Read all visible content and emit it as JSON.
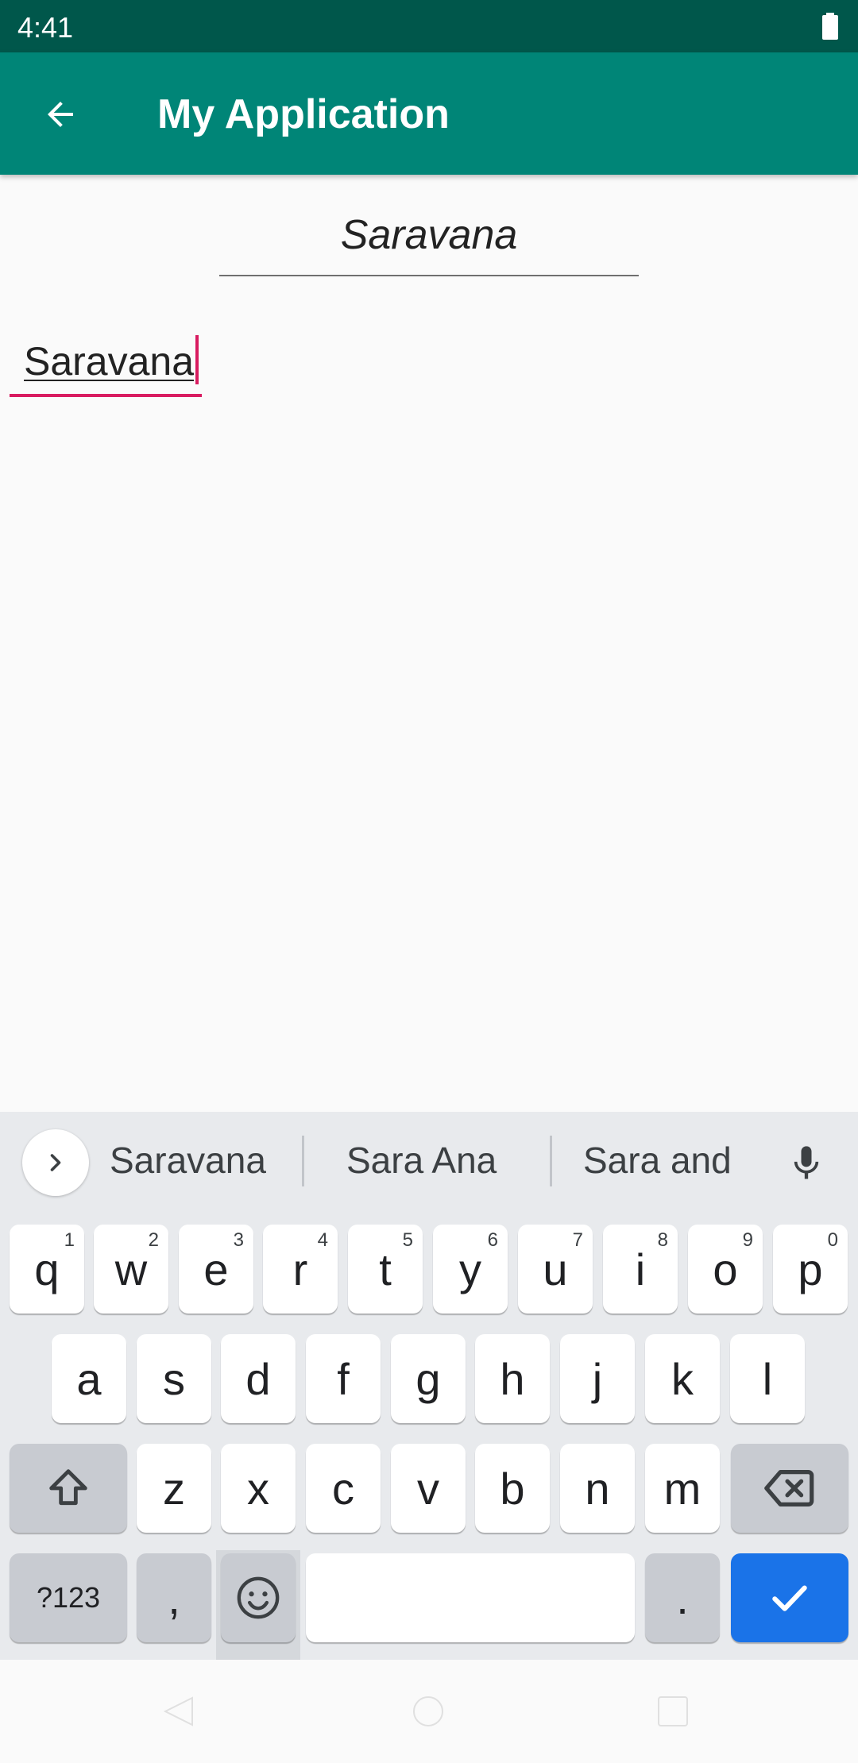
{
  "status_bar": {
    "time": "4:41",
    "battery_icon": "battery-full-icon"
  },
  "app_bar": {
    "title": "My Application",
    "back_icon": "arrow-back-icon"
  },
  "content": {
    "top_field_value": "Saravana",
    "edit_field_value": "Saravana"
  },
  "keyboard": {
    "suggestions": [
      "Saravana",
      "Sara Ana",
      "Sara and"
    ],
    "row1": [
      {
        "key": "q",
        "hint": "1"
      },
      {
        "key": "w",
        "hint": "2"
      },
      {
        "key": "e",
        "hint": "3"
      },
      {
        "key": "r",
        "hint": "4"
      },
      {
        "key": "t",
        "hint": "5"
      },
      {
        "key": "y",
        "hint": "6"
      },
      {
        "key": "u",
        "hint": "7"
      },
      {
        "key": "i",
        "hint": "8"
      },
      {
        "key": "o",
        "hint": "9"
      },
      {
        "key": "p",
        "hint": "0"
      }
    ],
    "row2": [
      "a",
      "s",
      "d",
      "f",
      "g",
      "h",
      "j",
      "k",
      "l"
    ],
    "row3": [
      "z",
      "x",
      "c",
      "v",
      "b",
      "n",
      "m"
    ],
    "symbols_label": "?123",
    "comma_label": ",",
    "period_label": ".",
    "space_label": ""
  },
  "colors": {
    "status_bar": "#00574b",
    "app_bar": "#008577",
    "accent": "#d81b60",
    "enter_key": "#1a73e8"
  }
}
